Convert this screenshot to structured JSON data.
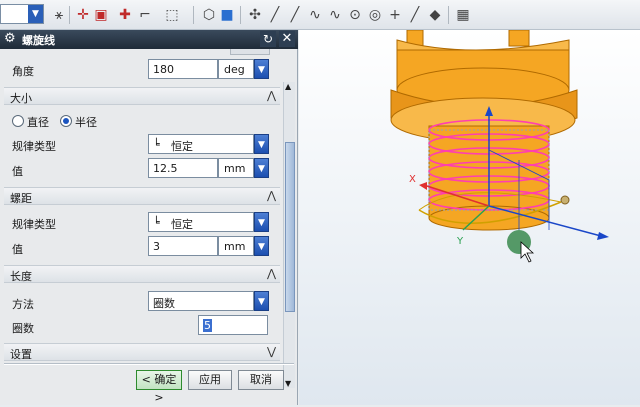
{
  "dialog": {
    "title": "螺旋线",
    "angle": {
      "label": "角度",
      "value": "180",
      "unit": "deg"
    },
    "size": {
      "section": "大小",
      "radio_diameter": "直径",
      "radio_radius": "半径",
      "law_type_label": "规律类型",
      "law_type_value": "恒定",
      "value_label": "值",
      "value": "12.5",
      "unit": "mm"
    },
    "pitch": {
      "section": "螺距",
      "law_type_label": "规律类型",
      "law_type_value": "恒定",
      "value_label": "值",
      "value": "3",
      "unit": "mm"
    },
    "length": {
      "section": "长度",
      "method_label": "方法",
      "method_value": "圈数",
      "turns_label": "圈数",
      "turns_value": "5"
    },
    "settings": {
      "section": "设置"
    },
    "buttons": {
      "ok": "< 确定 >",
      "apply": "应用",
      "cancel": "取消"
    }
  },
  "viewport": {
    "axis_x": "X",
    "axis_y": "Y",
    "colors": {
      "body": "#f5a623",
      "helix": "#ff3fb0",
      "axis_z": "#1a47c8",
      "axis_x": "#e03030",
      "axis_y": "#2aa050"
    }
  }
}
